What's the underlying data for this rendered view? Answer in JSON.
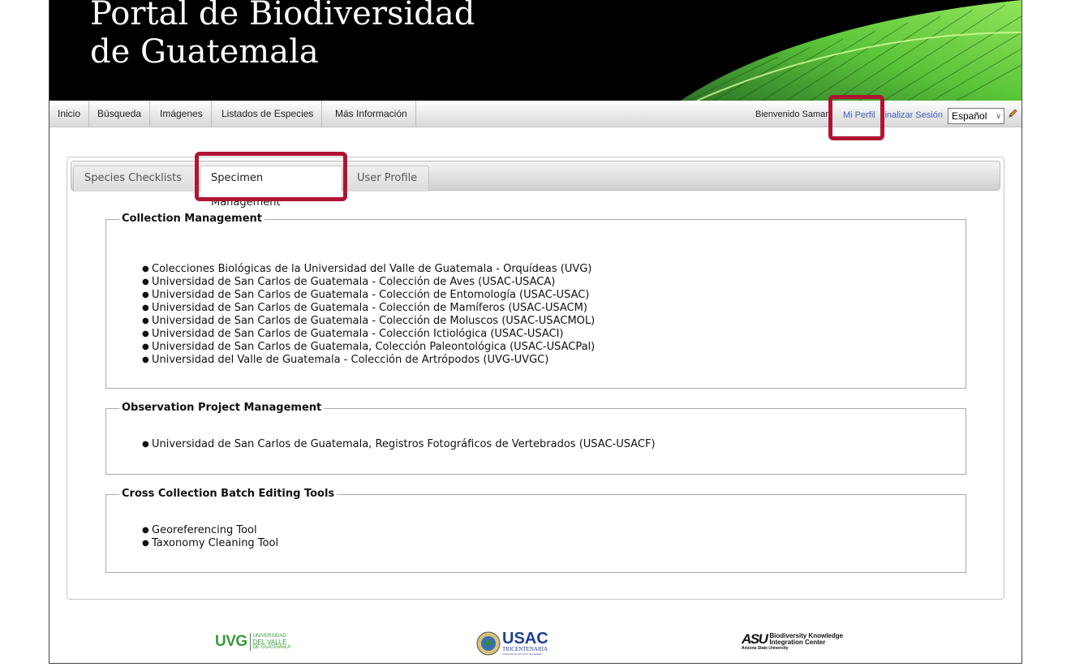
{
  "banner": {
    "title_line1": "Portal de Biodiversidad",
    "title_line2": "de Guatemala"
  },
  "menu": {
    "items": [
      {
        "label": "Inicio"
      },
      {
        "label": "Búsqueda"
      },
      {
        "label": "Imágenes"
      },
      {
        "label": "Listados de Especies"
      },
      {
        "label": "Más Información"
      }
    ],
    "welcome": "Bienvenido Samantha",
    "profile_link": "Mi Perfil",
    "logout_link": "Finalizar Sesión",
    "language": "Español"
  },
  "tabs": [
    {
      "label": "Species Checklists"
    },
    {
      "label": "Specimen Management"
    },
    {
      "label": "User Profile"
    }
  ],
  "active_tab": "Specimen Management",
  "sections": {
    "collection": {
      "title": "Collection Management",
      "items": [
        "Colecciones Biológicas de la Universidad del Valle de Guatemala - Orquídeas (UVG)",
        "Universidad de San Carlos de Guatemala - Colección de Aves (USAC-USACA)",
        "Universidad de San Carlos de Guatemala - Colección de Entomología (USAC-USAC)",
        "Universidad de San Carlos de Guatemala - Colección de Mamíferos (USAC-USACM)",
        "Universidad de San Carlos de Guatemala - Colección de Moluscos (USAC-USACMOL)",
        "Universidad de San Carlos de Guatemala - Colección Ictiológica (USAC-USACI)",
        "Universidad de San Carlos de Guatemala, Colección Paleontológica (USAC-USACPal)",
        "Universidad del Valle de Guatemala - Colección de Artrópodos (UVG-UVGC)"
      ]
    },
    "observation": {
      "title": "Observation Project Management",
      "items": [
        "Universidad de San Carlos de Guatemala, Registros Fotográficos de Vertebrados (USAC-USACF)"
      ]
    },
    "batch": {
      "title": "Cross Collection Batch Editing Tools",
      "items": [
        "Georeferencing Tool",
        "Taxonomy Cleaning Tool"
      ]
    }
  },
  "footer": {
    "uvg": {
      "abbr": "UVG",
      "name_line1": "UNIVERSIDAD",
      "name_line2": "DEL VALLE",
      "name_line3": "DE GUATEMALA"
    },
    "usac": {
      "abbr": "USAC",
      "sub": "TRICENTENARIA",
      "sub2": "Universidad de San Carlos de Guatemala"
    },
    "asu": {
      "abbr": "ASU",
      "line1": "Biodiversity Knowledge",
      "line2": "Integration Center",
      "line3": "Arizona State University"
    }
  },
  "colors": {
    "highlight": "#b01433",
    "link": "#3b5fb8",
    "uvg_green": "#3a9a3a",
    "usac_blue": "#1f3f8f"
  }
}
